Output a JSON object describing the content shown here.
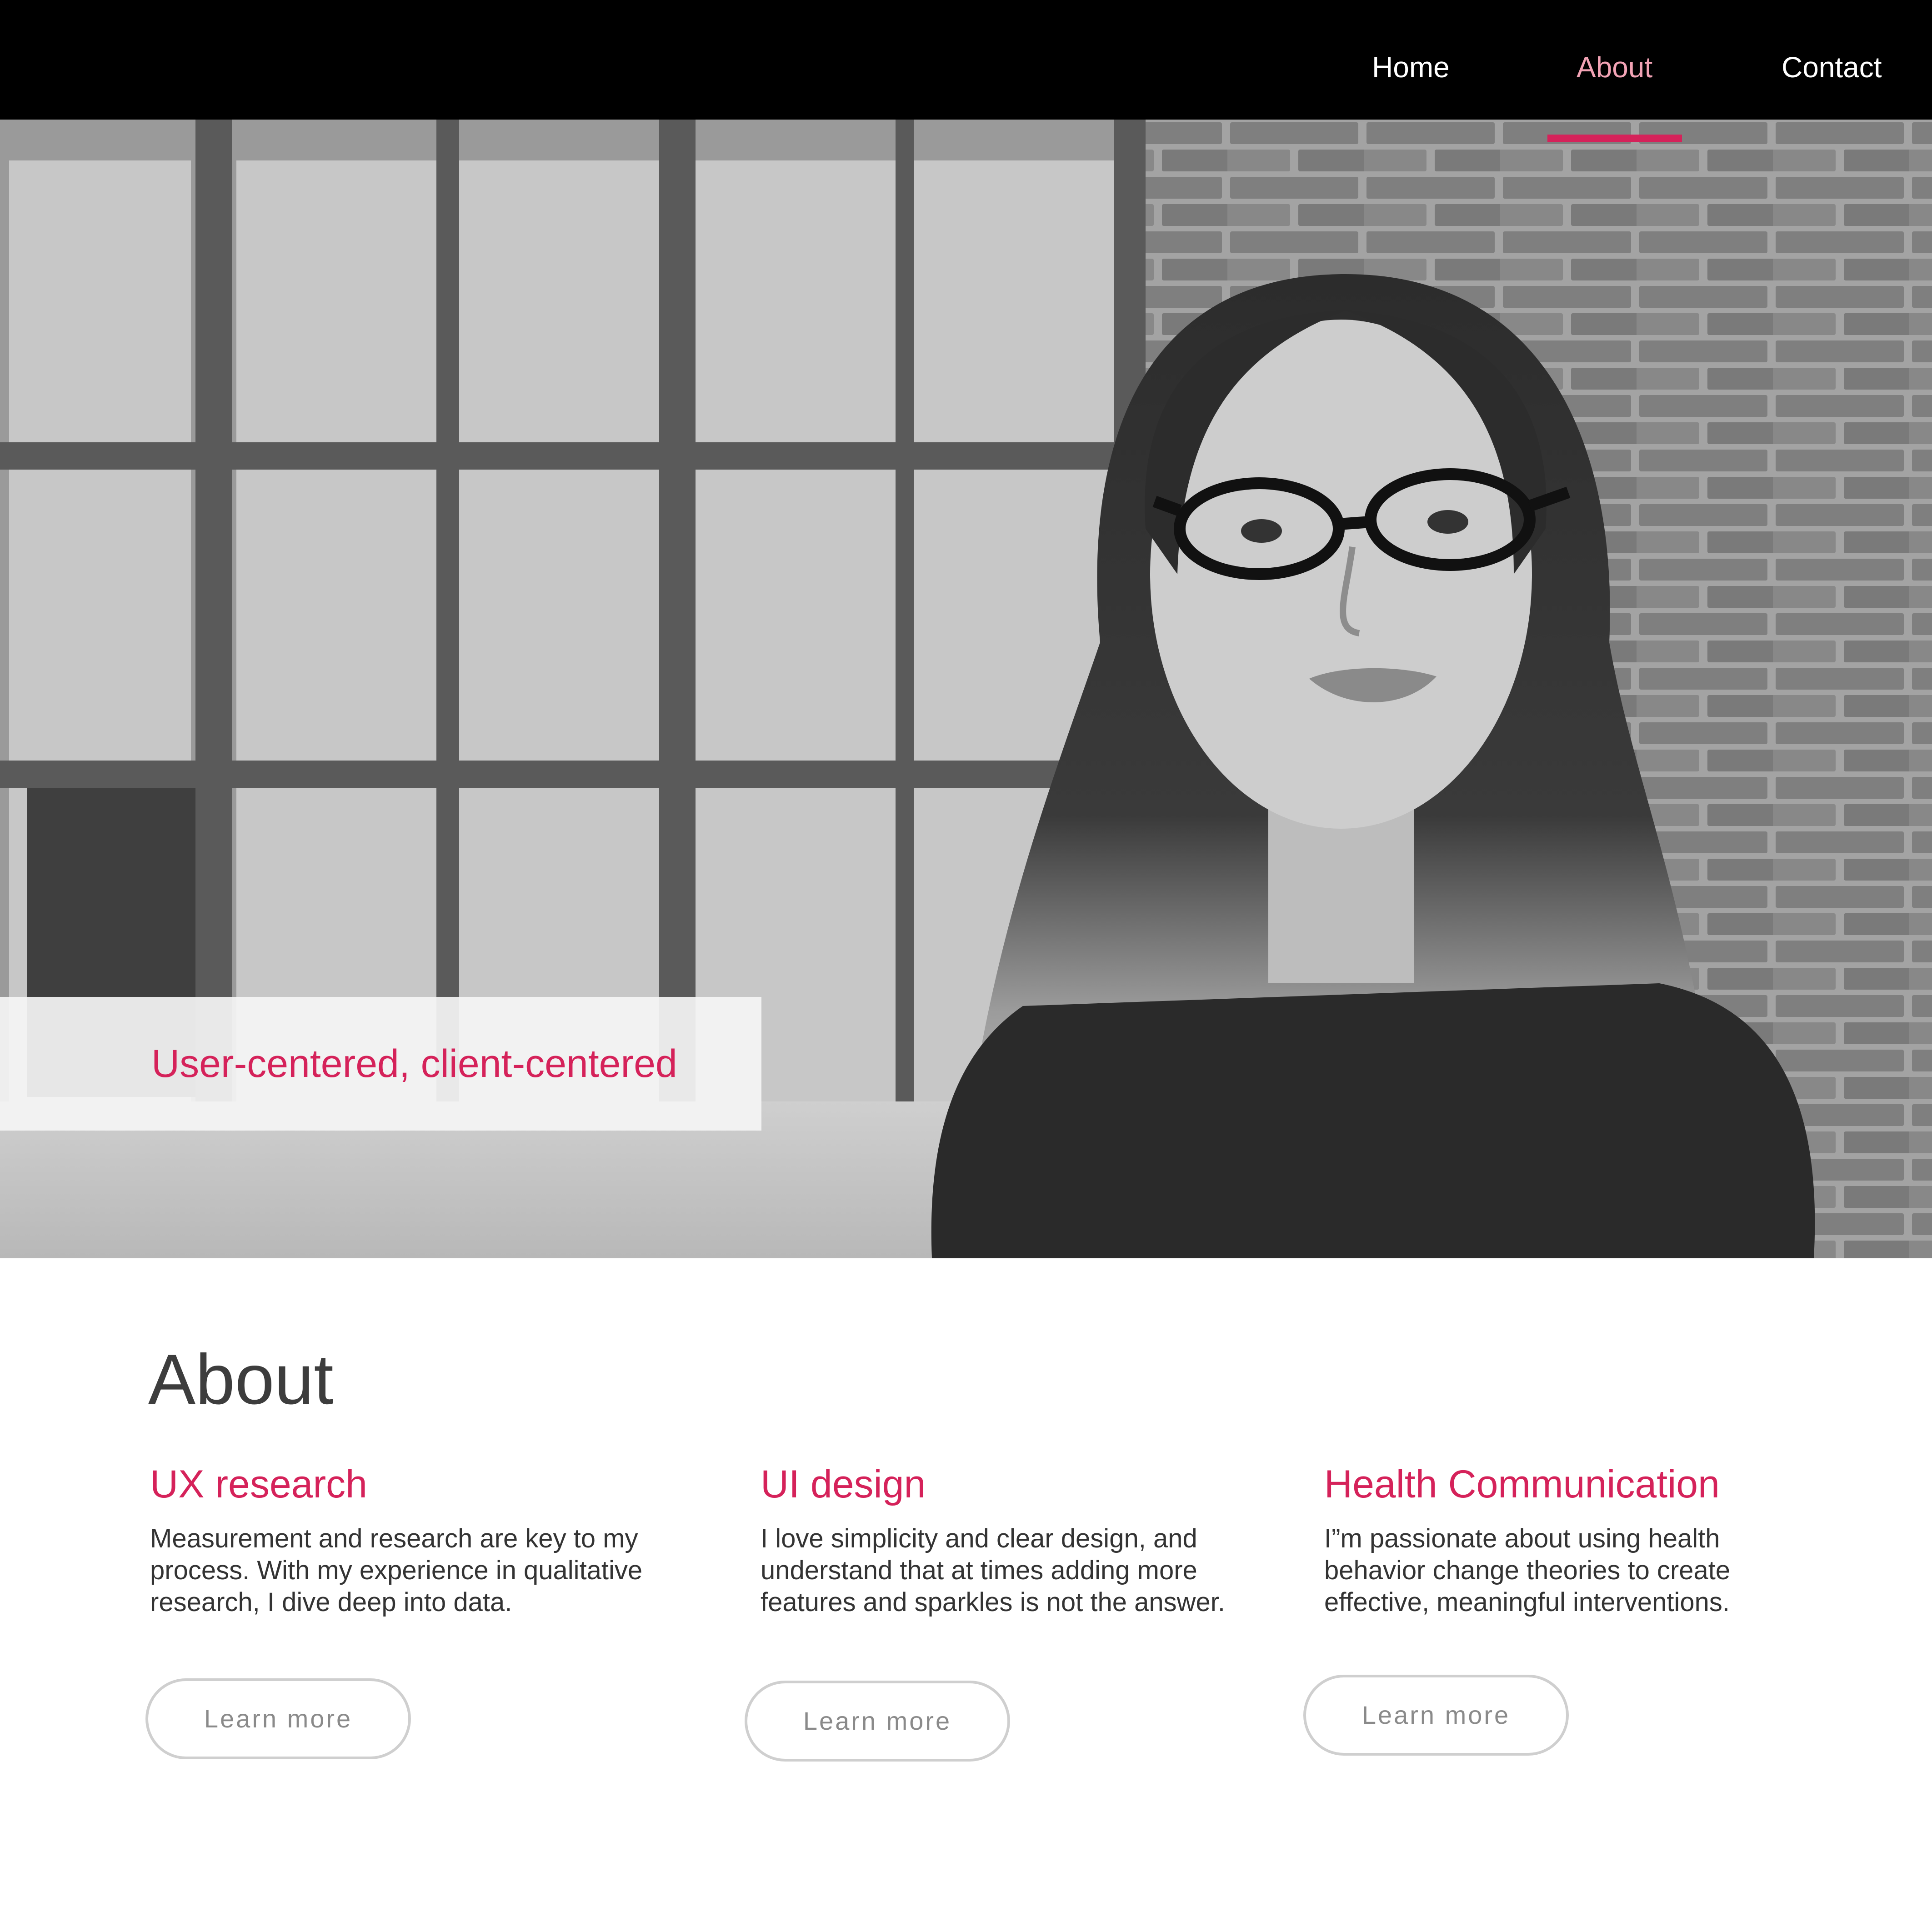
{
  "nav": {
    "items": [
      {
        "label": "Home",
        "active": false
      },
      {
        "label": "About",
        "active": true
      },
      {
        "label": "Contact",
        "active": false
      }
    ]
  },
  "hero": {
    "tagline": "User-centered, client-centered"
  },
  "about": {
    "title": "About",
    "columns": [
      {
        "title": "UX research",
        "lines": [
          "Measurement and research are key to my",
          "process. With my experience in qualitative",
          "research, I dive deep into data."
        ],
        "button": "Learn more"
      },
      {
        "title": "UI design",
        "lines": [
          "I love simplicity and clear design, and",
          "understand that at times adding more",
          "features and sparkles is not the answer."
        ],
        "button": "Learn more"
      },
      {
        "title": "Health Communication",
        "lines": [
          "I”m passionate about using health",
          "behavior change theories  to create",
          "effective, meaningful interventions."
        ],
        "button": "Learn more"
      }
    ]
  },
  "colors": {
    "nav_bg": "#000000",
    "accent": "#d5225a",
    "active_nav": "#f2a3b5",
    "heading": "#3d3d3d",
    "body_text": "#333333",
    "button_border": "#cfcfcf"
  }
}
